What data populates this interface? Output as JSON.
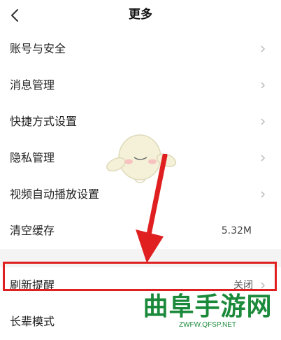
{
  "header": {
    "title": "更多"
  },
  "settings": {
    "items": [
      {
        "label": "账号与安全",
        "value": ""
      },
      {
        "label": "消息管理",
        "value": ""
      },
      {
        "label": "快捷方式设置",
        "value": ""
      },
      {
        "label": "隐私管理",
        "value": ""
      },
      {
        "label": "视频自动播放设置",
        "value": ""
      },
      {
        "label": "清空缓存",
        "value": "5.32M"
      }
    ],
    "items2": [
      {
        "label": "刷新提醒",
        "value": "关闭"
      },
      {
        "label": "长辈模式",
        "value": ""
      }
    ]
  },
  "watermark": {
    "text": "曲阜手游网",
    "url": "ZWFW.QFSP.NET"
  },
  "colors": {
    "highlight": "#e02020",
    "watermark": "#1a8a3a",
    "divider_bg": "#f4f4f4"
  },
  "icons": {
    "back": "chevron-left-icon",
    "row": "chevron-right-icon"
  }
}
